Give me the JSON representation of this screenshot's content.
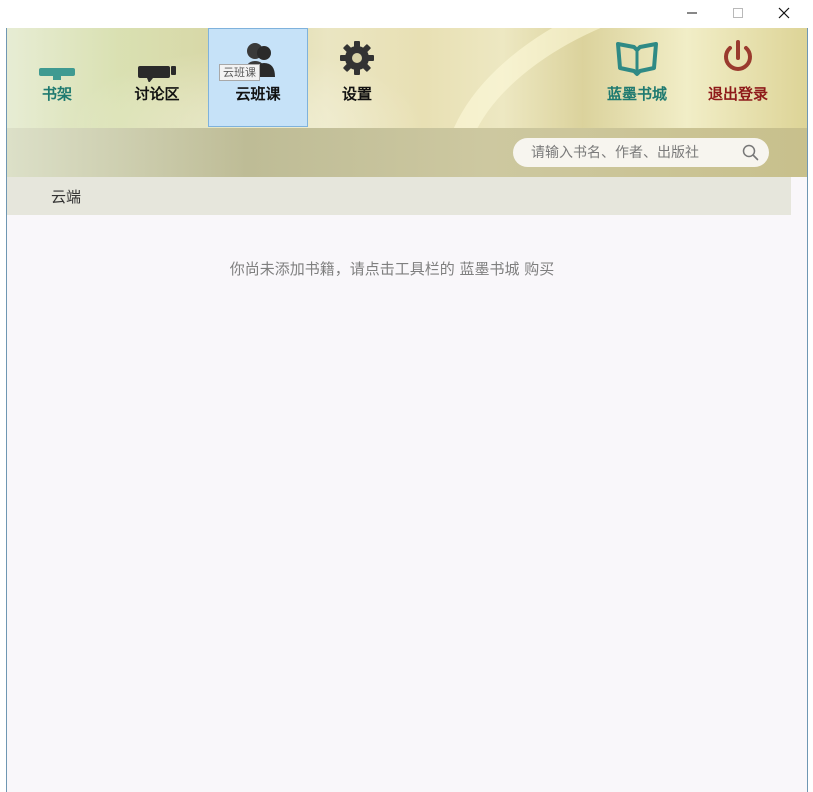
{
  "window": {
    "controls": {
      "minimize": "—",
      "maximize": "☐",
      "close": "✕"
    }
  },
  "toolbar": {
    "items": [
      {
        "id": "shelf",
        "label": "书架",
        "icon": "monitor-icon",
        "color": "#1f7a70"
      },
      {
        "id": "forum",
        "label": "讨论区",
        "icon": "chat-icon",
        "color": "#111111"
      },
      {
        "id": "cloud",
        "label": "云班课",
        "icon": "users-icon",
        "color": "#111111",
        "selected": true
      },
      {
        "id": "settings",
        "label": "设置",
        "icon": "gear-icon",
        "color": "#111111"
      },
      {
        "id": "store",
        "label": "蓝墨书城",
        "icon": "open-book-icon",
        "color": "#1f7a70"
      },
      {
        "id": "logout",
        "label": "退出登录",
        "icon": "power-icon",
        "color": "#8e1a1a"
      }
    ],
    "tooltip": "云班课",
    "selected_highlight": "#c6e2f8"
  },
  "search": {
    "placeholder": "请输入书名、作者、出版社",
    "value": ""
  },
  "tabs": {
    "cloud": "云端"
  },
  "content": {
    "empty_message": "你尚未添加书籍，请点击工具栏的 蓝墨书城 购买"
  }
}
